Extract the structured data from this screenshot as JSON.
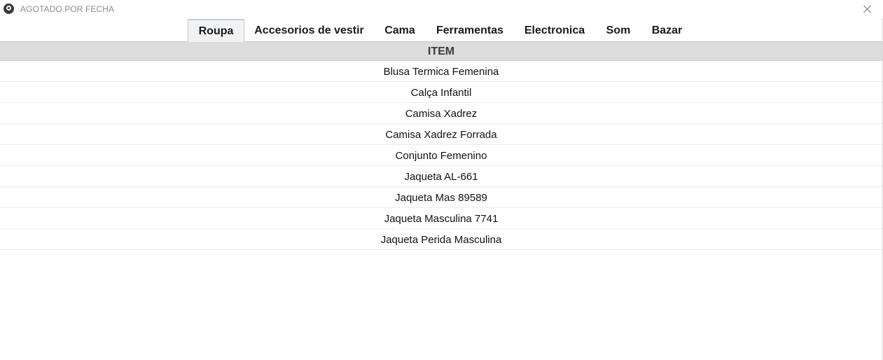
{
  "window": {
    "title": "AGOTADO POR FECHA",
    "icon": "app-logo-icon",
    "close_icon": "close-icon"
  },
  "tabs": [
    {
      "label": "Roupa",
      "active": true
    },
    {
      "label": "Accesorios de vestir",
      "active": false
    },
    {
      "label": "Cama",
      "active": false
    },
    {
      "label": "Ferramentas",
      "active": false
    },
    {
      "label": "Electronica",
      "active": false
    },
    {
      "label": "Som",
      "active": false
    },
    {
      "label": "Bazar",
      "active": false
    }
  ],
  "table": {
    "header": "ITEM",
    "rows": [
      "Blusa Termica Femenina",
      "Calça Infantil",
      "Camisa Xadrez",
      "Camisa Xadrez Forrada",
      "Conjunto Femenino",
      "Jaqueta AL-661",
      "Jaqueta Mas 89589",
      "Jaqueta Masculina 7741",
      "Jaqueta Perida Masculina"
    ]
  },
  "colors": {
    "header_bg": "#dcdcdc",
    "active_tab_bg": "#f2f2f2",
    "active_tab_accent": "#b9cfe8"
  }
}
